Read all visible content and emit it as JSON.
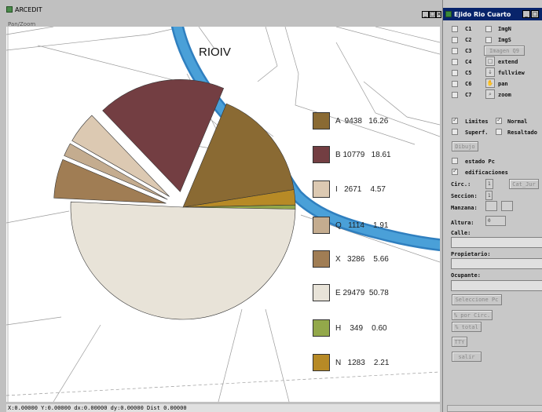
{
  "main_window": {
    "title": "ARCEDIT",
    "menu": "Pan/Zoom",
    "buttons": {
      "minimize": "_",
      "maximize": "□",
      "close": "×"
    }
  },
  "map": {
    "title": "RIOIV",
    "colors": {
      "river": "#4aa0d8",
      "river_edge": "#2f7fbf"
    }
  },
  "chart_data": {
    "type": "pie",
    "title": "",
    "categories": [
      "A",
      "B",
      "I",
      "Q",
      "X",
      "E",
      "H",
      "N"
    ],
    "values": [
      9438,
      10779,
      2671,
      1114,
      3286,
      29479,
      349,
      1283
    ],
    "percents": [
      16.26,
      18.61,
      4.57,
      1.91,
      5.66,
      50.78,
      0.6,
      2.21
    ],
    "colors": [
      "#8a6a33",
      "#733e42",
      "#dcc9b2",
      "#c4ac8f",
      "#a07d54",
      "#e8e3d8",
      "#93a84a",
      "#b78a26"
    ],
    "legend_labels": [
      "A  9438   16.26",
      "B 10779   18.61",
      "I   2671    4.57",
      "Q   1114    1.91",
      "X   3286    5.66",
      "E 29479  50.78",
      "H    349    0.60",
      "N   1283    2.21"
    ]
  },
  "status_bar": "X:0.00000 Y:0.00000 dx:0.00000 dy:0.00000 Dist 0.00000",
  "side_panel": {
    "title": "Ejido Rio Cuarto",
    "buttons": {
      "minimize": "_",
      "maximize": "□"
    },
    "layers_left": [
      "C1",
      "C2",
      "C3",
      "C4",
      "C5",
      "C6",
      "C7"
    ],
    "tools": {
      "imgn": "ImgN",
      "imgs": "ImgS",
      "imagen_q9": "Imagen Q9",
      "extend": "extend",
      "fullview": "fullview",
      "pan": "pan",
      "zoom": "zoom"
    },
    "options": {
      "limites": "Limites",
      "normal": "Normal",
      "superf": "Superf.",
      "resaltado": "Resaltado"
    },
    "dibujo": "Dibujo",
    "estado_pc": "estado Pc",
    "edificaciones": "edificaciones",
    "circ_label": "Circ.:",
    "circ_value": "1",
    "cat_jur": "Cat_Jur",
    "seccion_label": "Seccion:",
    "seccion_value": "1",
    "manzana_label": "Manzana:",
    "altura_label": "Altura:",
    "altura_value": "0",
    "calle_label": "Calle:",
    "propietario_label": "Propietario:",
    "ocupante_label": "Ocupante:",
    "seleccione_pc": "Seleccione Pc",
    "pct_circ": "% por Circ.",
    "pct_total": "% total",
    "tty": "TTY",
    "salir": "salir"
  }
}
